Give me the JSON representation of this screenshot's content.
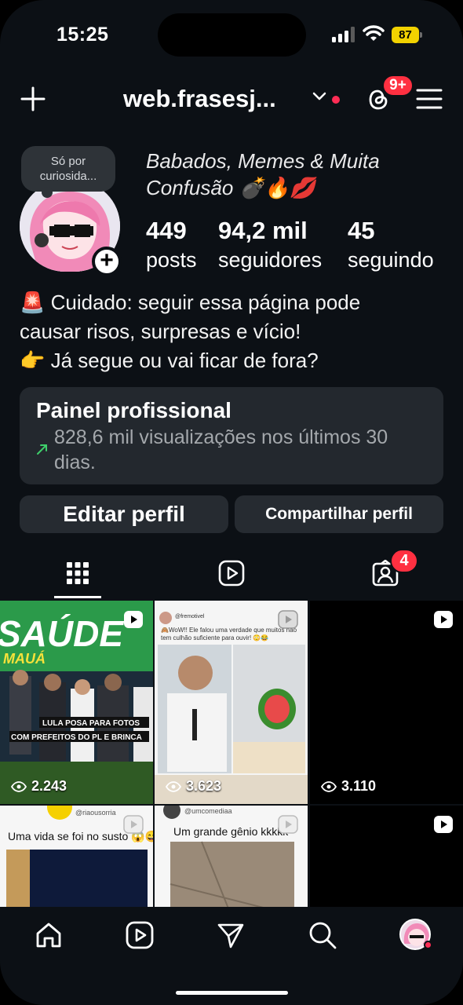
{
  "status_bar": {
    "time": "15:25",
    "battery": "87",
    "icons": [
      "signal-icon",
      "wifi-icon",
      "battery-icon"
    ]
  },
  "header": {
    "username": "web.frasesj...",
    "threads_badge": "9+",
    "icons": [
      "plus-icon",
      "chevron-down-icon",
      "threads-icon",
      "menu-icon"
    ]
  },
  "profile": {
    "note": "Só por curiosida...",
    "name_line1": "Babados, Memes & Muita",
    "name_line2": "Confusão 💣🔥💋",
    "stats": [
      {
        "value": "449",
        "label": "posts"
      },
      {
        "value": "94,2 mil",
        "label": "seguidores"
      },
      {
        "value": "45",
        "label": "seguindo"
      }
    ],
    "bio": [
      "🚨 Cuidado: seguir essa página pode",
      "causar risos, surpresas e vício!",
      "👉 Já segue ou vai ficar de fora?"
    ]
  },
  "dashboard": {
    "title": "Painel profissional",
    "subtitle": "828,6 mil visualizações nos últimos 30 dias."
  },
  "actions": {
    "edit": "Editar perfil",
    "share": "Compartilhar perfil"
  },
  "tabs": {
    "tagged_badge": "4"
  },
  "posts": [
    {
      "views": "2.243",
      "caption": "LULA POSA PARA FOTOS COM PREFEITOS DO PL E BRINCA: \"PRESIDENTE DO PARTIDO VAI BATER NELES\"",
      "top_text": "SAÚDE",
      "sub_text": "MAUÁ"
    },
    {
      "views": "3.623",
      "handle": "@fremotivel",
      "tweet": "🙈WoW!! Ele falou uma verdade que muitos não tem culhão suficiente para ouvir! 😳😂"
    },
    {
      "views": "3.110"
    },
    {
      "handle": "@riaousorria",
      "caption": "Uma vida se foi no susto 😱😅"
    },
    {
      "handle": "@umcomediaa",
      "caption": "Um grande gênio kkkkk"
    },
    {}
  ],
  "nav": [
    "home-icon",
    "reels-icon",
    "direct-icon",
    "search-icon",
    "profile-avatar"
  ]
}
